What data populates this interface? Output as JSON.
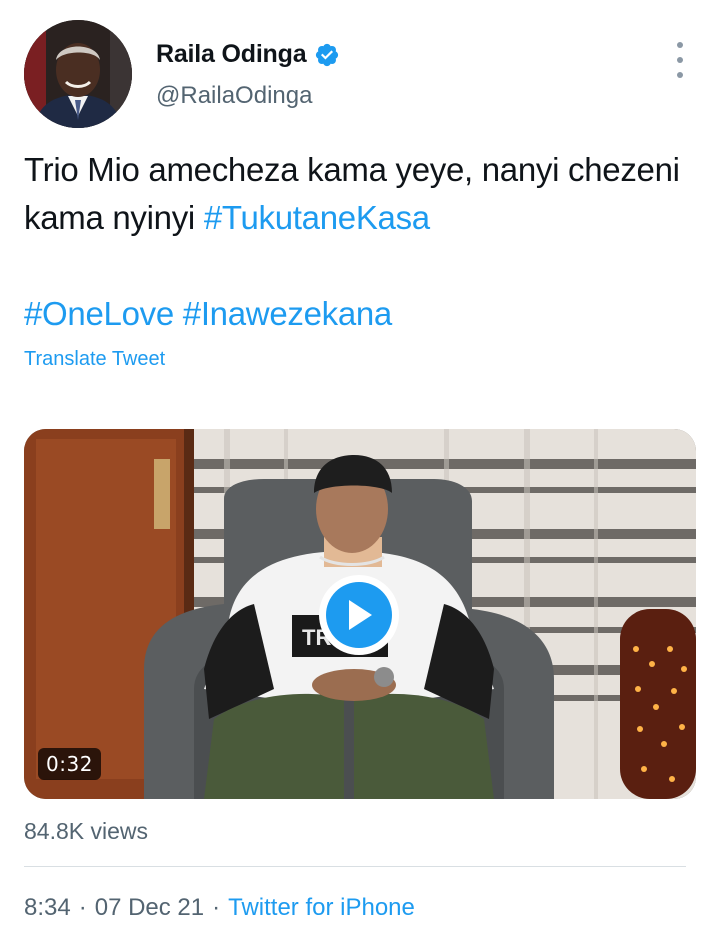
{
  "author": {
    "display_name": "Raila Odinga",
    "handle": "@RailaOdinga",
    "verified_icon": "verified-badge-icon",
    "accent_color": "#1d9bf0"
  },
  "tweet": {
    "text_plain": "Trio Mio amecheza kama yeye, nanyi chezeni kama nyinyi ",
    "hashtag_1": "#TukutaneKasa",
    "hashtag_2": "#OneLove",
    "hashtag_3": "#Inawezekana",
    "translate_label": "Translate Tweet"
  },
  "video": {
    "duration": "0:32",
    "shirt_text": "TR",
    "play_icon": "play-icon"
  },
  "stats": {
    "views": "84.8K views"
  },
  "footer": {
    "time": "8:34",
    "separator": "·",
    "date": "07 Dec 21",
    "source": "Twitter for iPhone"
  }
}
